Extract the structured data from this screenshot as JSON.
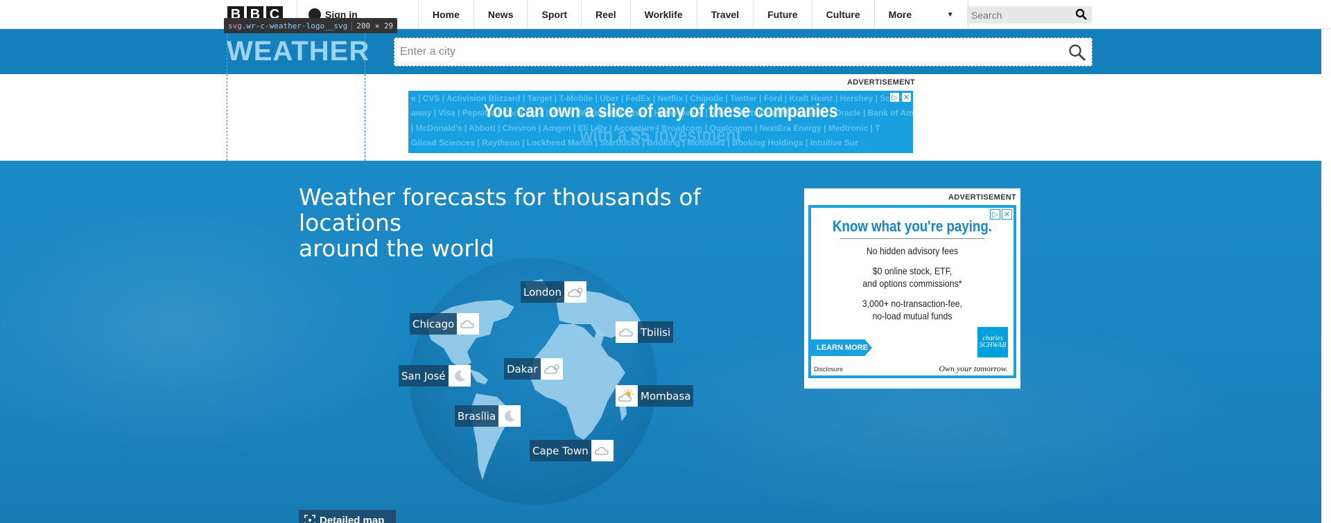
{
  "topnav": {
    "logo_letters": [
      "B",
      "B",
      "C"
    ],
    "signin_label": "Sign in",
    "links": [
      "Home",
      "News",
      "Sport",
      "Reel",
      "Worklife",
      "Travel",
      "Future",
      "Culture"
    ],
    "more_label": "More",
    "search_placeholder": "Search"
  },
  "inspector": {
    "tag": "svg",
    "cls": ".wr-c-weather-logo__svg",
    "size": "200 × 29"
  },
  "weather_bar": {
    "logo_text": "WEATHER",
    "city_search_placeholder": "Enter a city"
  },
  "top_ad": {
    "label": "ADVERTISEMENT",
    "ticker_rows": [
      "e | CVS | Activision Blizzard | Target | T-Mobile | Uber | FedEx | Netflix | Chipotle | Twitter | Ford | Kraft Heinz | Hershey | South",
      "away | Visa | PepsiCo | Coca-Cola | Pfizer | Walmart | Disney | Home Depot | Nike | Starbucks | McDonald's | Oracle | Bank of Am",
      "| McDonald's | Abbott | Chevron | Amgen | Eli Lilly | Accenture | Broadcom | Qualcomm | NextEra Energy | Medtronic | T",
      "Gilead Sciences | Raytheon | Lockheed Martin | Starbucks | Booking | Mondelez | Booking Holdings | Intuitive Sur"
    ],
    "headline": "You can own a slice of any of these companies",
    "subline": "with a $5 investment"
  },
  "hero": {
    "title_line1": "Weather forecasts for thousands of locations",
    "title_line2": "around the world",
    "detailed_map_label": "Detailed map"
  },
  "locations": [
    {
      "name": "London",
      "icon": "cloud-sun-icon"
    },
    {
      "name": "Chicago",
      "icon": "cloud-icon"
    },
    {
      "name": "Tbilisi",
      "icon": "cloud-icon"
    },
    {
      "name": "San José",
      "icon": "moon-icon"
    },
    {
      "name": "Dakar",
      "icon": "cloud-sun-icon"
    },
    {
      "name": "Mombasa",
      "icon": "sun-cloud-icon"
    },
    {
      "name": "Brasília",
      "icon": "moon-icon"
    },
    {
      "name": "Cape Town",
      "icon": "cloud-icon"
    }
  ],
  "side_ad": {
    "label": "ADVERTISEMENT",
    "headline": "Know what you're paying.",
    "lines": [
      "No hidden advisory fees",
      "$0 online stock, ETF,",
      "and options commissions*",
      "3,000+ no-transaction-fee,",
      "no-load mutual funds"
    ],
    "learn_more": "LEARN MORE",
    "brand": "charles SCHWAB",
    "disclosure": "Disclosure",
    "tagline": "Own your tomorrow."
  },
  "colors": {
    "weather_blue": "#1380bc",
    "hero_blue": "#1a84c0",
    "ad_blue": "#19a0e0"
  }
}
